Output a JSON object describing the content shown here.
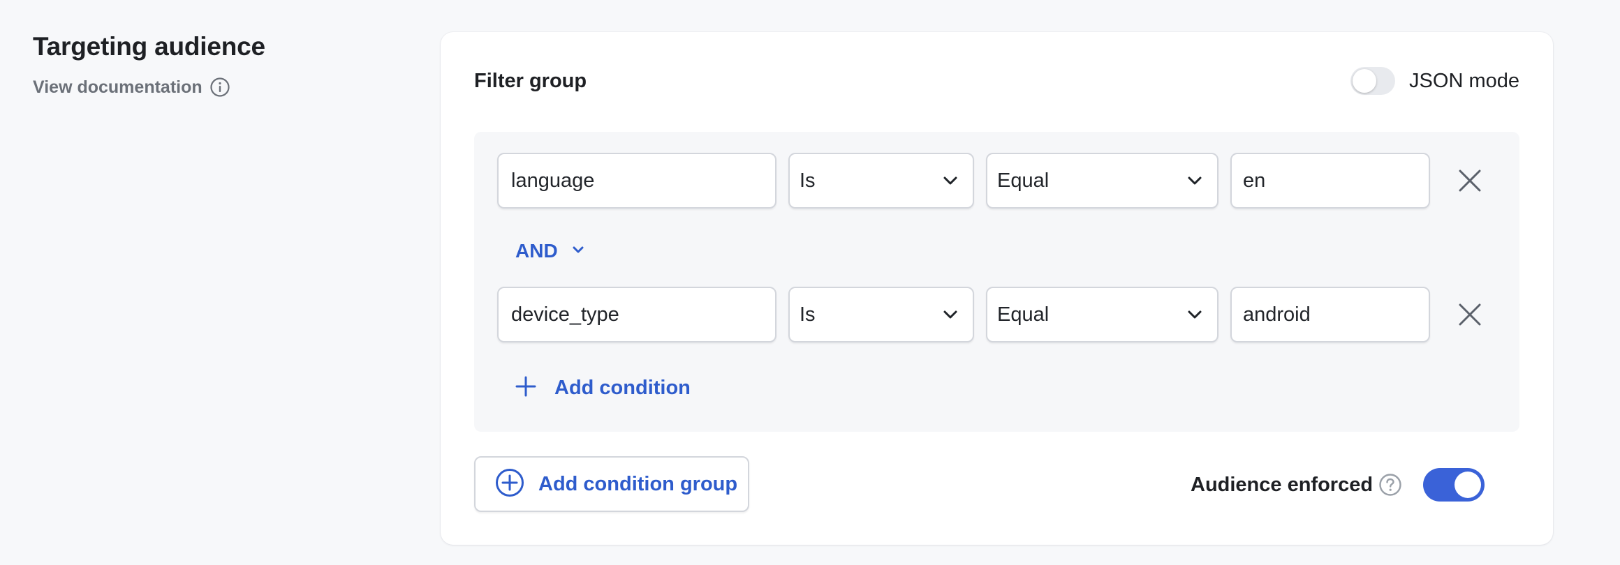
{
  "header": {
    "title": "Targeting audience",
    "doc_link": "View documentation"
  },
  "filter_group": {
    "title": "Filter group",
    "json_mode_label": "JSON mode",
    "json_mode_on": false,
    "conditions": [
      {
        "field": "language",
        "operator": "Is",
        "comparator": "Equal",
        "value": "en"
      },
      {
        "field": "device_type",
        "operator": "Is",
        "comparator": "Equal",
        "value": "android"
      }
    ],
    "joiner": "AND",
    "add_condition_label": "Add condition"
  },
  "footer": {
    "add_group_label": "Add condition group",
    "enforced_label": "Audience enforced",
    "enforced_on": true
  },
  "icons": {
    "info": "info-icon",
    "help": "question-icon",
    "chevron": "chevron-down-icon",
    "remove": "close-icon",
    "plus": "plus-icon",
    "plus_circle": "plus-circle-icon"
  },
  "colors": {
    "accent": "#2e5ccc",
    "toggle_on": "#3a62d8",
    "background": "#f7f8fa"
  }
}
